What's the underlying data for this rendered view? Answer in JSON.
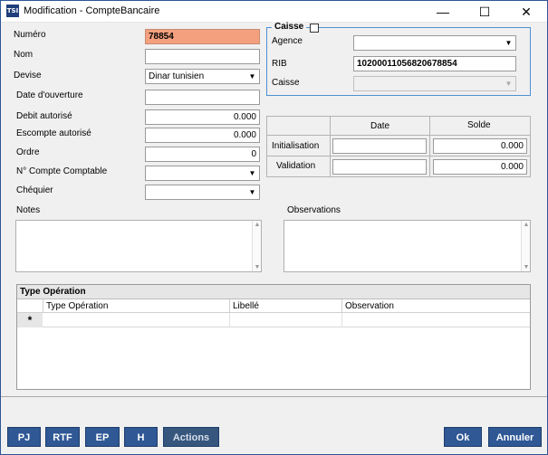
{
  "window": {
    "title": "Modification - CompteBancaire",
    "app_icon_text": "TSI"
  },
  "controls": {
    "minimize": "—",
    "maximize": "☐",
    "close": "✕"
  },
  "form": {
    "numero": {
      "label": "Numéro",
      "value": "78854"
    },
    "nom": {
      "label": "Nom",
      "value": ""
    },
    "devise": {
      "label": "Devise",
      "value": "Dinar tunisien"
    },
    "date_ouverture": {
      "label": "Date d'ouverture",
      "value": ""
    },
    "debit_autorise": {
      "label": "Debit autorisé",
      "value": "0.000"
    },
    "escompte_autorise": {
      "label": "Escompte autorisé",
      "value": "0.000"
    },
    "ordre": {
      "label": "Ordre",
      "value": "0"
    },
    "compte_comptable": {
      "label": "N° Compte Comptable",
      "value": ""
    },
    "chequier": {
      "label": "Chéquier",
      "value": ""
    }
  },
  "caisse_group": {
    "title": "Caisse",
    "agence": {
      "label": "Agence",
      "value": ""
    },
    "rib": {
      "label": "RIB",
      "value": "10200011056820678854"
    },
    "caisse": {
      "label": "Caisse",
      "value": ""
    }
  },
  "soldes": {
    "headers": [
      "Date",
      "Solde"
    ],
    "rows": [
      {
        "label": "Initialisation",
        "date": "",
        "solde": "0.000"
      },
      {
        "label": "Validation",
        "date": "",
        "solde": "0.000"
      }
    ]
  },
  "notes": {
    "label": "Notes",
    "value": ""
  },
  "observations": {
    "label": "Observations",
    "value": ""
  },
  "type_operation": {
    "title": "Type Opération",
    "columns": [
      "Type Opération",
      "Libellé",
      "Observation"
    ],
    "new_row_marker": "*"
  },
  "buttons": {
    "pj": "PJ",
    "rtf": "RTF",
    "ep": "EP",
    "h": "H",
    "actions": "Actions",
    "ok": "Ok",
    "annuler": "Annuler"
  },
  "colors": {
    "numero_bg": "#f4a07f",
    "button_blue": "#2f5895",
    "group_border": "#4d90d0"
  }
}
